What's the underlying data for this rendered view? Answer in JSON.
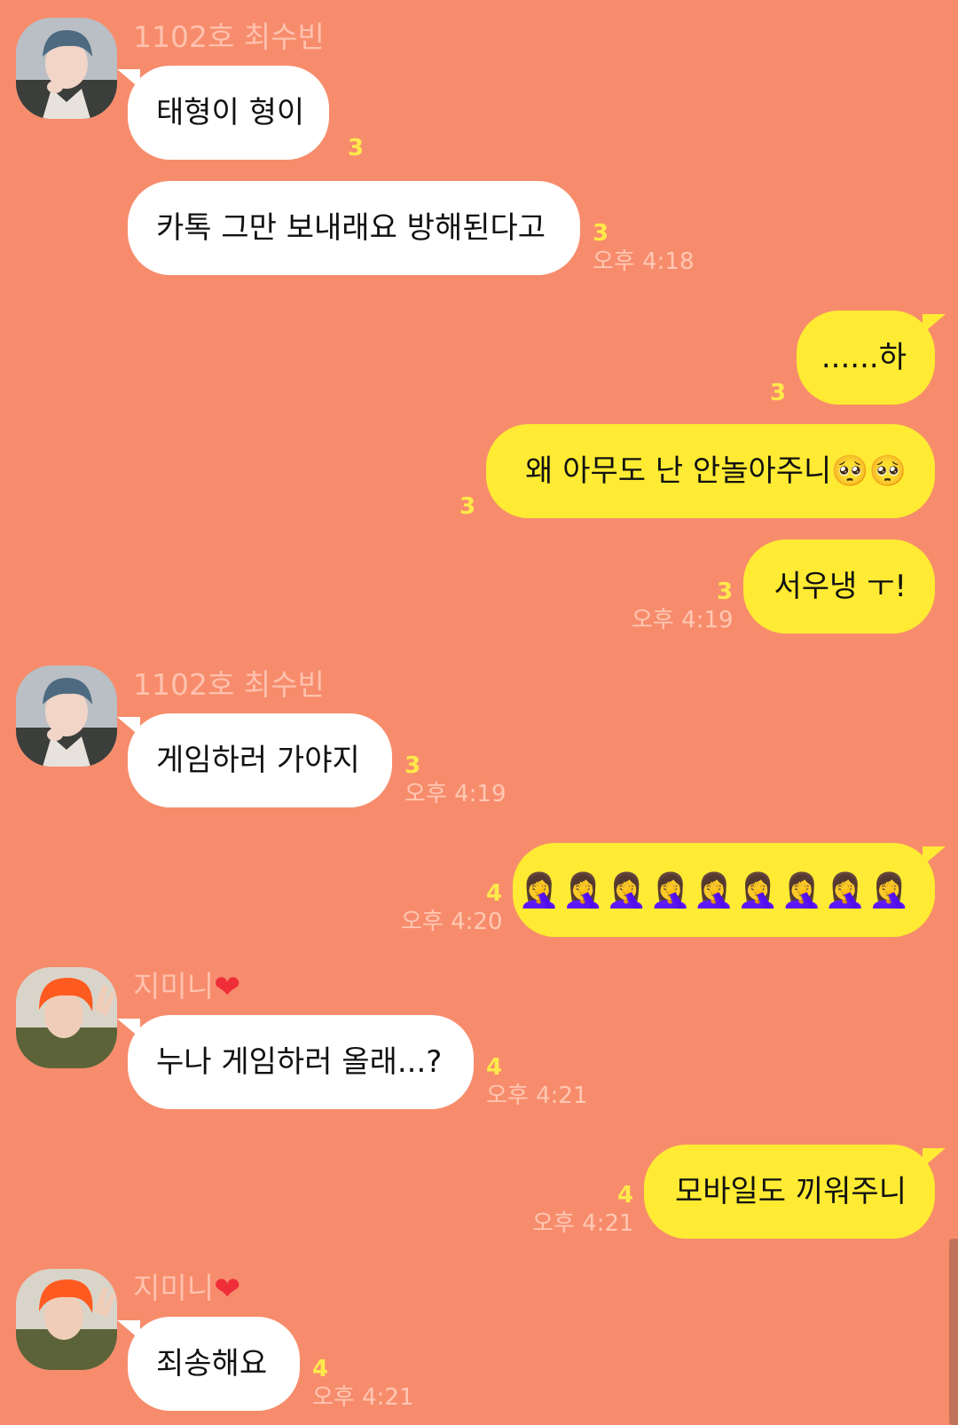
{
  "colors": {
    "background": "#F78C6C",
    "incoming_bubble": "#FFFFFF",
    "outgoing_bubble": "#FFEB33",
    "unread_count": "#FFE94A",
    "timestamp": "#FFC8B4",
    "sender_name": "#FFC1AE",
    "heart": "#F02E3A"
  },
  "senders": {
    "soobin": {
      "name": "1102호 최수빈",
      "avatar_icon": "profile-photo-blue-hair"
    },
    "jimin": {
      "name": "지미니",
      "name_suffix_icon": "red-heart-emoji",
      "heart": "❤",
      "avatar_icon": "profile-photo-orange-hair"
    }
  },
  "messages": [
    {
      "direction": "in",
      "sender": "1102호 최수빈",
      "text": "태형이 형이",
      "unread": "3",
      "time": ""
    },
    {
      "direction": "in",
      "sender": "",
      "text": "카톡 그만 보내래요 방해된다고",
      "unread": "3",
      "time": "오후 4:18"
    },
    {
      "direction": "out",
      "text": "......하",
      "unread": "3",
      "time": ""
    },
    {
      "direction": "out",
      "text": "왜 아무도 난 안놀아주니🥺🥺",
      "unread": "3",
      "time": ""
    },
    {
      "direction": "out",
      "text": "서우냉 ㅜ!",
      "unread": "3",
      "time": "오후 4:19"
    },
    {
      "direction": "in",
      "sender": "1102호 최수빈",
      "text": "게임하러 가야지",
      "unread": "3",
      "time": "오후 4:19"
    },
    {
      "direction": "out",
      "text": "🤦‍♀️🤦‍♀️🤦‍♀️🤦‍♀️🤦‍♀️🤦‍♀️🤦‍♀️🤦‍♀️🤦‍♀️",
      "unread": "4",
      "time": "오후 4:20"
    },
    {
      "direction": "in",
      "sender": "지미니",
      "text": "누나 게임하러 올래...?",
      "unread": "4",
      "time": "오후 4:21"
    },
    {
      "direction": "out",
      "text": "모바일도 끼워주니",
      "unread": "4",
      "time": "오후 4:21"
    },
    {
      "direction": "in",
      "sender": "지미니",
      "text": "죄송해요",
      "unread": "4",
      "time": "오후 4:21"
    }
  ]
}
